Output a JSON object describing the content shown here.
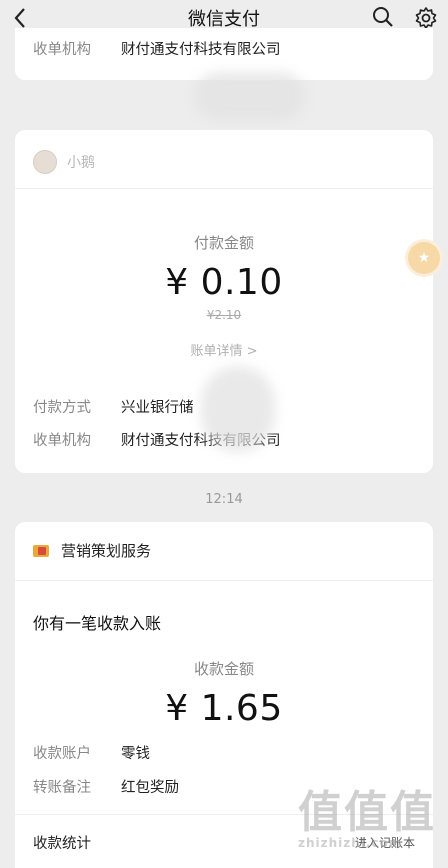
{
  "header": {
    "title": "微信支付",
    "back_icon": "chevron-left-icon",
    "search_icon": "search-icon",
    "settings_icon": "gear-icon"
  },
  "top_card": {
    "label": "收单机构",
    "value": "财付通支付科技有限公司"
  },
  "payment_card": {
    "merchant_name": "小鹅",
    "amount_label": "付款金额",
    "amount": "¥ 0.10",
    "original_amount": "¥2.10",
    "detail_link": "账单详情 >",
    "rows": [
      {
        "label": "付款方式",
        "value": "兴业银行储"
      },
      {
        "label": "收单机构",
        "value": "财付通支付科技有限公司"
      }
    ]
  },
  "timestamp": "12:14",
  "float_button_icon": "star-icon",
  "marketing_card": {
    "service_name": "营销策划服务",
    "headline": "你有一笔收款入账",
    "amount_label": "收款金额",
    "amount": "¥ 1.65",
    "rows": [
      {
        "label": "收款账户",
        "value": "零钱"
      },
      {
        "label": "转账备注",
        "value": "红包奖励"
      }
    ],
    "footer_left": "收款统计",
    "footer_right": "进入记账本"
  },
  "watermark": {
    "big": "值值值",
    "small": "zhizhizhi.com"
  }
}
